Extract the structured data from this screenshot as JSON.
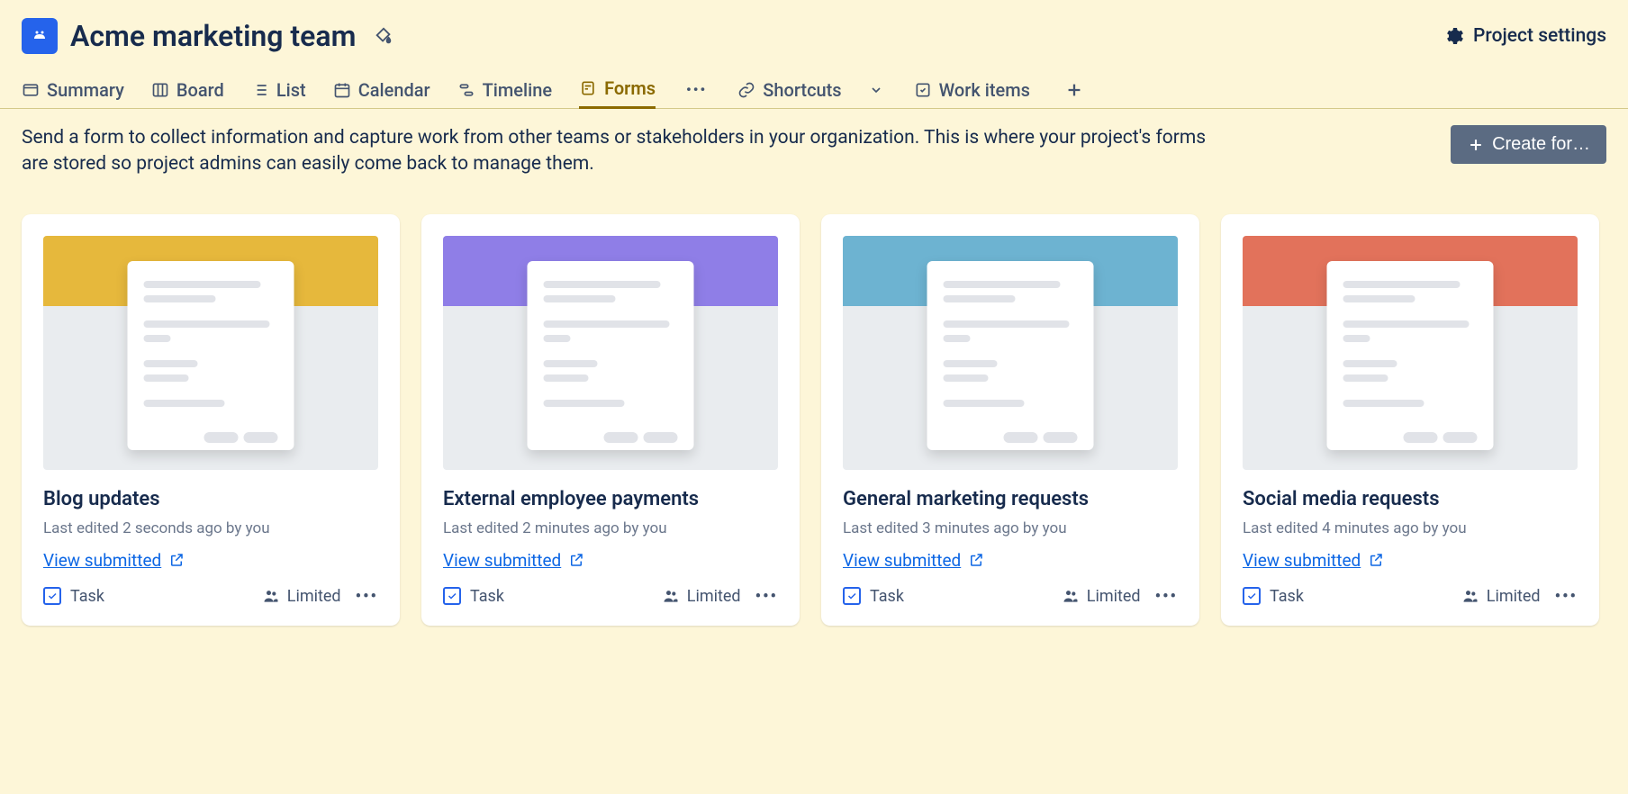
{
  "header": {
    "project_title": "Acme marketing team",
    "settings_label": "Project settings"
  },
  "tabs": {
    "summary": "Summary",
    "board": "Board",
    "list": "List",
    "calendar": "Calendar",
    "timeline": "Timeline",
    "forms": "Forms",
    "shortcuts": "Shortcuts",
    "work_items": "Work items"
  },
  "description": "Send a form to collect information and capture work from other teams or stakeholders in your organization. This is where your project's forms are stored so project admins can easily come back to manage them.",
  "create_button": "Create for…",
  "common": {
    "view_submitted": "View submitted",
    "task_label": "Task",
    "limited_label": "Limited"
  },
  "cards": [
    {
      "title": "Blog updates",
      "meta": "Last edited 2 seconds ago by you",
      "banner_color": "#e6b83c"
    },
    {
      "title": "External employee payments",
      "meta": "Last edited 2 minutes ago by you",
      "banner_color": "#8f7ee7"
    },
    {
      "title": "General marketing requests",
      "meta": "Last edited 3 minutes ago by you",
      "banner_color": "#6db3d1"
    },
    {
      "title": "Social media requests",
      "meta": "Last edited 4 minutes ago by you",
      "banner_color": "#e2725b"
    }
  ]
}
